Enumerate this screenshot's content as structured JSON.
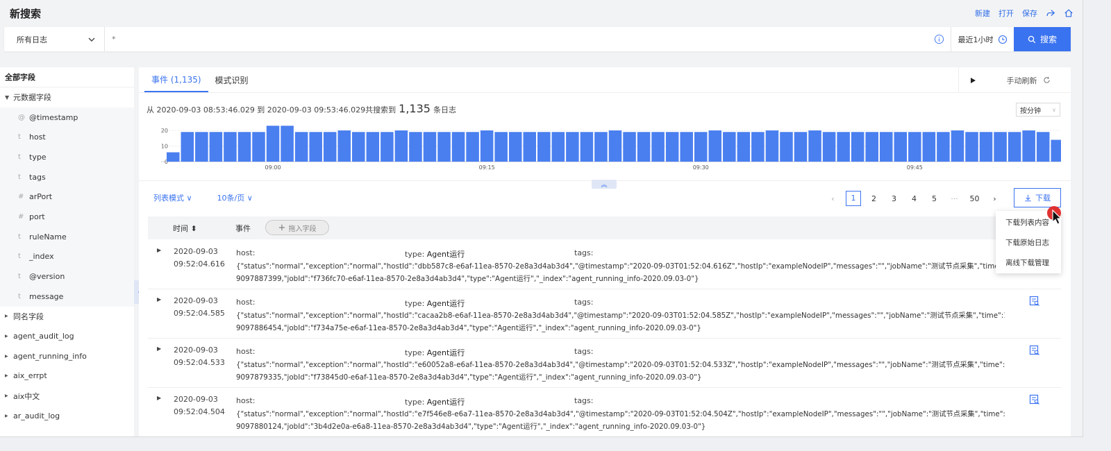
{
  "header": {
    "title": "新搜索",
    "actions": [
      "新建",
      "打开",
      "保存"
    ],
    "icons": [
      "share-icon",
      "home-icon"
    ]
  },
  "search": {
    "log_select": "所有日志",
    "query": "*",
    "time_range": "最近1小时",
    "button": "搜索"
  },
  "sidebar": {
    "title": "全部字段",
    "meta_group": "元数据字段",
    "meta_fields": [
      {
        "type": "@",
        "name": "@timestamp"
      },
      {
        "type": "t",
        "name": "host"
      },
      {
        "type": "t",
        "name": "type"
      },
      {
        "type": "t",
        "name": "tags"
      },
      {
        "type": "#",
        "name": "arPort"
      },
      {
        "type": "#",
        "name": "port"
      },
      {
        "type": "t",
        "name": "ruleName"
      },
      {
        "type": "t",
        "name": "_index"
      },
      {
        "type": "t",
        "name": "@version"
      },
      {
        "type": "t",
        "name": "message"
      }
    ],
    "groups": [
      "同名字段",
      "agent_audit_log",
      "agent_running_info",
      "aix_errpt",
      "aix中文",
      "ar_audit_log"
    ]
  },
  "tabs": {
    "events": "事件 (1,135)",
    "patterns": "模式识别",
    "refresh": "手动刷新"
  },
  "summary": {
    "prefix": "从 2020-09-03 08:53:46.029 到 2020-09-03 09:53:46.029共搜索到",
    "count": "1,135",
    "suffix": "条日志",
    "interval": "按分钟"
  },
  "chart_data": {
    "type": "bar",
    "y_ticks": [
      "20",
      "10",
      "0"
    ],
    "ylim": [
      0,
      24
    ],
    "x_tick_labels": [
      {
        "label": "09:00",
        "index": 7
      },
      {
        "label": "09:15",
        "index": 22
      },
      {
        "label": "09:30",
        "index": 37
      },
      {
        "label": "09:45",
        "index": 52
      }
    ],
    "values": [
      6,
      19,
      19,
      19,
      19,
      19,
      19,
      23,
      23,
      19,
      19,
      19,
      20,
      19,
      19,
      19,
      20,
      19,
      19,
      19,
      19,
      19,
      20,
      19,
      19,
      19,
      19,
      19,
      19,
      19,
      19,
      20,
      19,
      19,
      19,
      19,
      19,
      19,
      20,
      19,
      19,
      19,
      20,
      19,
      19,
      20,
      19,
      19,
      19,
      19,
      19,
      19,
      19,
      19,
      19,
      20,
      19,
      19,
      19,
      19,
      20,
      19,
      14
    ],
    "color": "#4a7ff0"
  },
  "list_toolbar": {
    "mode": "列表模式",
    "per_page": "10条/页",
    "pages": [
      "1",
      "2",
      "3",
      "4",
      "5",
      "···",
      "50"
    ],
    "download": "下载"
  },
  "table": {
    "col_time": "时间",
    "col_event": "事件",
    "add_field": "拖入字段"
  },
  "rows": [
    {
      "date": "2020-09-03",
      "time": "09:52:04.616",
      "host": "host:",
      "type_label": "type:",
      "type_value": "Agent运行",
      "tags": "tags:",
      "json1": "{\"status\":\"normal\",\"exception\":\"normal\",\"hostId\":\"dbb587c8-e6af-11ea-8570-2e8a3d4ab3d4\",\"@timestamp\":\"2020-09-03T01:52:04.616Z\",\"hostIp\":\"exampleNodeIP\",\"messages\":\"\",\"jobName\":\"测试节点采集\",\"time\":159",
      "json2": "9097887399,\"jobId\":\"f736fc70-e6af-11ea-8570-2e8a3d4ab3d4\",\"type\":\"Agent运行\",\"_index\":\"agent_running_info-2020.09.03-0\"}"
    },
    {
      "date": "2020-09-03",
      "time": "09:52:04.585",
      "host": "host:",
      "type_label": "type:",
      "type_value": "Agent运行",
      "tags": "tags:",
      "json1": "{\"status\":\"normal\",\"exception\":\"normal\",\"hostId\":\"cacaa2b8-e6af-11ea-8570-2e8a3d4ab3d4\",\"@timestamp\":\"2020-09-03T01:52:04.585Z\",\"hostIp\":\"exampleNodeIP\",\"messages\":\"\",\"jobName\":\"测试节点采集\",\"time\":159",
      "json2": "9097886454,\"jobId\":\"f734a75e-e6af-11ea-8570-2e8a3d4ab3d4\",\"type\":\"Agent运行\",\"_index\":\"agent_running_info-2020.09.03-0\"}"
    },
    {
      "date": "2020-09-03",
      "time": "09:52:04.533",
      "host": "host:",
      "type_label": "type:",
      "type_value": "Agent运行",
      "tags": "tags:",
      "json1": "{\"status\":\"normal\",\"exception\":\"normal\",\"hostId\":\"e60052a8-e6af-11ea-8570-2e8a3d4ab3d4\",\"@timestamp\":\"2020-09-03T01:52:04.533Z\",\"hostIp\":\"exampleNodeIP\",\"messages\":\"\",\"jobName\":\"测试节点采集\",\"time\":159",
      "json2": "9097879335,\"jobId\":\"f73845d0-e6af-11ea-8570-2e8a3d4ab3d4\",\"type\":\"Agent运行\",\"_index\":\"agent_running_info-2020.09.03-0\"}"
    },
    {
      "date": "2020-09-03",
      "time": "09:52:04.504",
      "host": "host:",
      "type_label": "type:",
      "type_value": "Agent运行",
      "tags": "tags:",
      "json1": "{\"status\":\"normal\",\"exception\":\"normal\",\"hostId\":\"e7f546e8-e6a7-11ea-8570-2e8a3d4ab3d4\",\"@timestamp\":\"2020-09-03T01:52:04.504Z\",\"hostIp\":\"exampleNodeIP\",\"messages\":\"\",\"jobName\":\"测试节点采集\",\"time\":159",
      "json2": "9097880124,\"jobId\":\"3b4d2e0a-e6a8-11ea-8570-2e8a3d4ab3d4\",\"type\":\"Agent运行\",\"_index\":\"agent_running_info-2020.09.03-0\"}"
    }
  ],
  "download_menu": [
    "下载列表内容",
    "下载原始日志",
    "离线下载管理"
  ]
}
